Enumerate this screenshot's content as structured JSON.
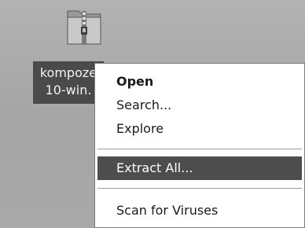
{
  "desktop": {
    "icon": {
      "name": "zip-folder-icon",
      "label_line1": "kompoze",
      "label_line2": "10-win."
    }
  },
  "context_menu": {
    "items": [
      {
        "label": "Open",
        "bold": true
      },
      {
        "label": "Search..."
      },
      {
        "label": "Explore"
      },
      {
        "label": "Extract All...",
        "selected": true
      },
      {
        "label": "Scan for Viruses"
      }
    ]
  },
  "colors": {
    "selection": "#4d4d4d",
    "desktop": "#a9a9a9",
    "menu_bg": "#ffffff"
  }
}
